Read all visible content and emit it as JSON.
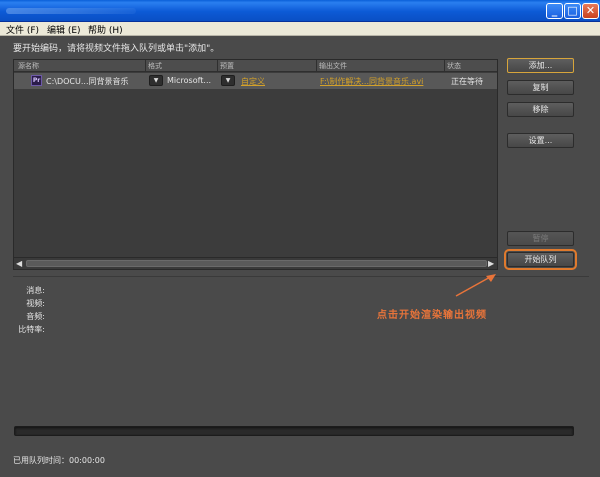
{
  "window": {
    "minimize_label": "_",
    "maximize_label": "□",
    "close_label": "✕"
  },
  "menu": [
    {
      "label": "文件 (F)"
    },
    {
      "label": "编辑 (E)"
    },
    {
      "label": "帮助 (H)"
    }
  ],
  "hint": "要开始编码，请将视频文件拖入队列或单击\"添加\"。",
  "queue": {
    "columns": [
      "源名称",
      "格式",
      "预置",
      "输出文件",
      "状态"
    ],
    "rows": [
      {
        "icon": "premiere-icon",
        "icon_text": "Pr",
        "source": "C:\\DOCU...同背景音乐",
        "format": "Microsoft...",
        "preset": "自定义",
        "output": "F:\\制作解决...同背景音乐.avi",
        "status": "正在等待"
      }
    ],
    "scroll_left": "◀",
    "scroll_right": "▶"
  },
  "buttons": {
    "add": "添加...",
    "copy": "复制",
    "remove": "移除",
    "settings": "设置...",
    "pause": "暂停",
    "start_queue": "开始队列"
  },
  "info_labels": {
    "message": "消息:",
    "video": "视频:",
    "audio": "音频:",
    "bitrate": "比特率:"
  },
  "annotation": {
    "text": "点击开始渲染输出视频",
    "color": "#e8743a"
  },
  "elapsed": {
    "label": "已用队列时间：",
    "value": "00:00:00"
  },
  "colors": {
    "background": "#4a4a4a",
    "link": "#d3a12a",
    "highlight_outline": "#e07a2d"
  }
}
